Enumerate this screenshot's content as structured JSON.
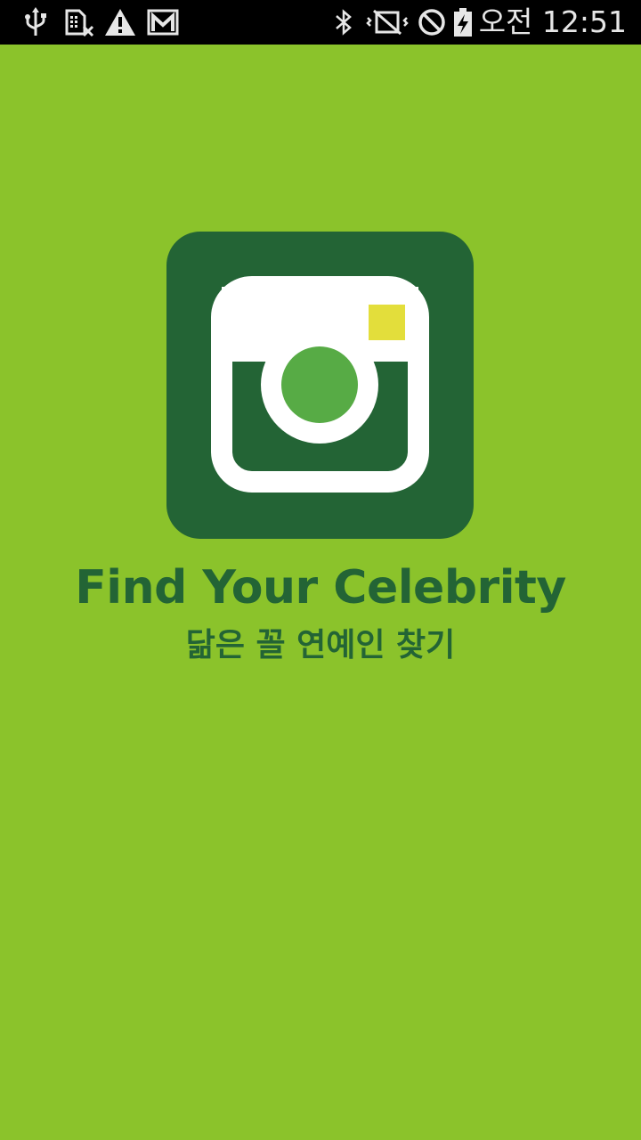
{
  "status_bar": {
    "left_icons": [
      "usb-icon",
      "sim-card-off-icon",
      "warning-icon",
      "gmail-icon"
    ],
    "right_icons": [
      "bluetooth-icon",
      "vibrate-mute-icon",
      "do-not-disturb-icon",
      "battery-charging-icon"
    ],
    "time": "오전 12:51"
  },
  "splash": {
    "logo_icon": "camera-icon",
    "title": "Find Your Celebrity",
    "subtitle": "닮은 꼴 연예인 찾기"
  },
  "colors": {
    "background": "#8bc32b",
    "logo_tile": "#236435",
    "lens": "#57ab45",
    "flash": "#e3de3b",
    "text": "#236435"
  }
}
